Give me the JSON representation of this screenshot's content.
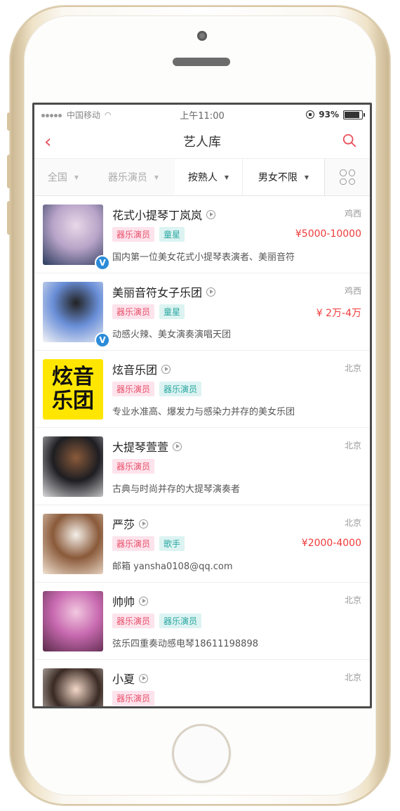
{
  "status_bar": {
    "carrier": "中国移动",
    "time": "上午11:00",
    "battery": "93%"
  },
  "nav": {
    "title": "艺人库",
    "back_icon": "chevron-left-icon",
    "search_icon": "search-icon"
  },
  "filters": [
    {
      "label": "全国",
      "active": false
    },
    {
      "label": "器乐演员",
      "active": false
    },
    {
      "label": "按熟人",
      "active": true
    },
    {
      "label": "男女不限",
      "active": true
    }
  ],
  "grid_icon": "grid-icon",
  "artists": [
    {
      "name": "花式小提琴丁岚岚",
      "location": "鸡西",
      "tags": [
        {
          "text": "器乐演员",
          "color": "pink"
        },
        {
          "text": "童星",
          "color": "teal"
        }
      ],
      "price": "¥5000-10000",
      "desc": "国内第一位美女花式小提琴表演者、美丽音符",
      "verified": true,
      "thumb_colors": [
        "#2a3a5c",
        "#b8a4c8",
        "#e8d8e8"
      ]
    },
    {
      "name": "美丽音符女子乐团",
      "location": "鸡西",
      "tags": [
        {
          "text": "器乐演员",
          "color": "pink"
        },
        {
          "text": "童星",
          "color": "teal"
        }
      ],
      "price": "¥ 2万-4万",
      "desc": "动感火辣、美女演奏演唱天团",
      "verified": true,
      "thumb_colors": [
        "#f4f4f6",
        "#6a8fd8",
        "#222"
      ]
    },
    {
      "name": "炫音乐团",
      "location": "北京",
      "tags": [
        {
          "text": "器乐演员",
          "color": "pink"
        },
        {
          "text": "器乐演员",
          "color": "teal"
        }
      ],
      "price": "",
      "desc": "专业水准高、爆发力与感染力并存的美女乐团",
      "verified": false,
      "thumb_text": "炫音乐团",
      "thumb_colors": [
        "#ffe600",
        "#111",
        "#111"
      ]
    },
    {
      "name": "大提琴萱萱",
      "location": "北京",
      "tags": [
        {
          "text": "器乐演员",
          "color": "pink"
        }
      ],
      "price": "",
      "desc": "古典与时尚并存的大提琴演奏者",
      "verified": false,
      "thumb_colors": [
        "#d9d9dc",
        "#1e1e22",
        "#8a5a3a"
      ]
    },
    {
      "name": "严莎",
      "location": "北京",
      "tags": [
        {
          "text": "器乐演员",
          "color": "pink"
        },
        {
          "text": "歌手",
          "color": "teal"
        }
      ],
      "price": "¥2000-4000",
      "desc": "邮箱 yansha0108@qq.com",
      "verified": false,
      "thumb_colors": [
        "#f2e2d2",
        "#8a5a3a",
        "#f5f0ea"
      ]
    },
    {
      "name": "帅帅",
      "location": "北京",
      "tags": [
        {
          "text": "器乐演员",
          "color": "pink"
        },
        {
          "text": "器乐演员",
          "color": "teal"
        }
      ],
      "price": "",
      "desc": "弦乐四重奏动感电琴18611198898",
      "verified": false,
      "thumb_colors": [
        "#5a2a4a",
        "#c86ab0",
        "#f2c8e0"
      ]
    },
    {
      "name": "小夏",
      "location": "北京",
      "tags": [
        {
          "text": "器乐演员",
          "color": "pink"
        }
      ],
      "price": "",
      "desc": "",
      "verified": false,
      "thumb_colors": [
        "#eee6e0",
        "#3a2a24",
        "#f2d8c8"
      ]
    }
  ]
}
